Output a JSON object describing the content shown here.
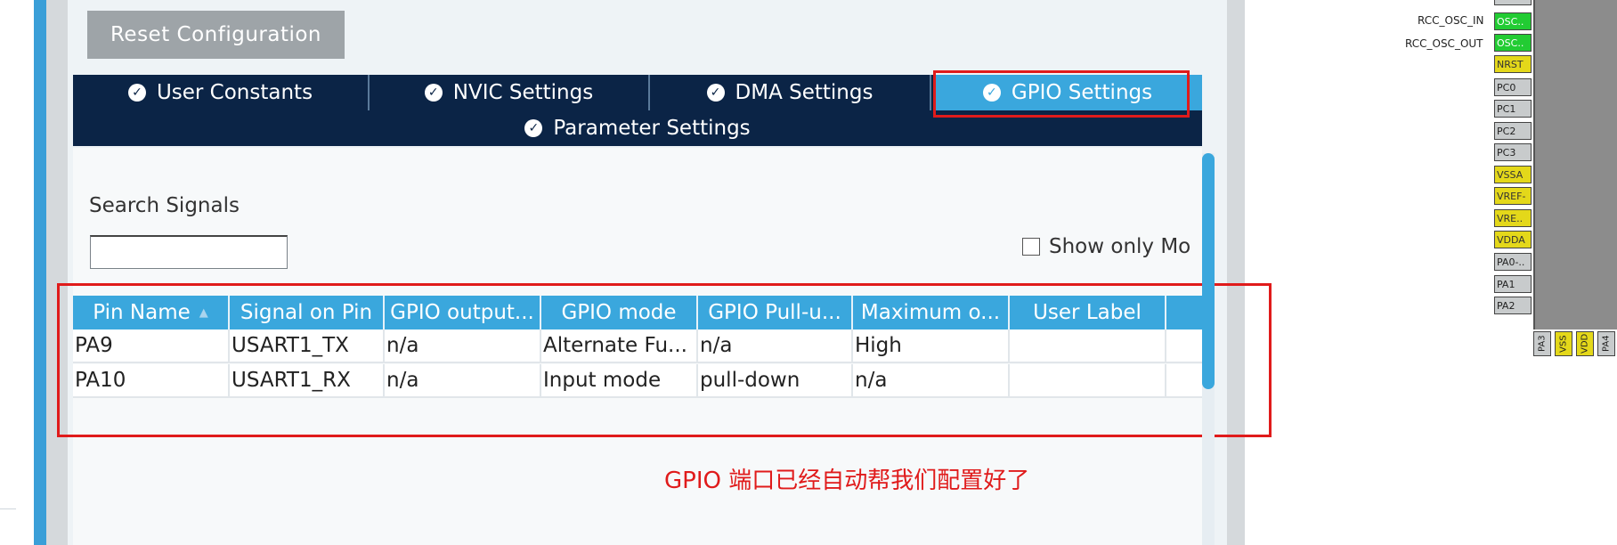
{
  "toolbar": {
    "reset_label": "Reset Configuration"
  },
  "tabs": {
    "row1": [
      {
        "label": "User Constants",
        "active": false
      },
      {
        "label": "NVIC Settings",
        "active": false
      },
      {
        "label": "DMA Settings",
        "active": false
      },
      {
        "label": "GPIO Settings",
        "active": true
      }
    ],
    "row2": [
      {
        "label": "Parameter Settings"
      }
    ]
  },
  "search": {
    "label": "Search Signals",
    "value": "",
    "placeholder": ""
  },
  "filter": {
    "show_only_label": "Show only Mo"
  },
  "table": {
    "headers": [
      "Pin Name",
      "Signal on Pin",
      "GPIO output...",
      "GPIO mode",
      "GPIO Pull-u...",
      "Maximum o...",
      "User Label",
      ""
    ],
    "rows": [
      [
        "PA9",
        "USART1_TX",
        "n/a",
        "Alternate Fu...",
        "n/a",
        "High",
        "",
        ""
      ],
      [
        "PA10",
        "USART1_RX",
        "n/a",
        "Input mode",
        "pull-down",
        "n/a",
        "",
        ""
      ]
    ]
  },
  "annotation": {
    "text": "GPIO 端口已经自动帮我们配置好了",
    "color": "#e01b1b"
  },
  "chip": {
    "signal_labels": [
      "RCC_OSC_IN",
      "RCC_OSC_OUT"
    ],
    "left_pins": [
      {
        "label": "",
        "color": "gray"
      },
      {
        "label": "OSC..",
        "color": "green"
      },
      {
        "label": "OSC..",
        "color": "green"
      },
      {
        "label": "NRST",
        "color": "yellow"
      },
      {
        "label": "PC0",
        "color": "gray"
      },
      {
        "label": "PC1",
        "color": "gray"
      },
      {
        "label": "PC2",
        "color": "gray"
      },
      {
        "label": "PC3",
        "color": "gray"
      },
      {
        "label": "VSSA",
        "color": "yellow"
      },
      {
        "label": "VREF-",
        "color": "yellow"
      },
      {
        "label": "VRE..",
        "color": "yellow"
      },
      {
        "label": "VDDA",
        "color": "yellow"
      },
      {
        "label": "PA0-..",
        "color": "gray"
      },
      {
        "label": "PA1",
        "color": "gray"
      },
      {
        "label": "PA2",
        "color": "gray"
      }
    ],
    "bottom_pins": [
      {
        "label": "PA3",
        "color": "gray"
      },
      {
        "label": "VSS",
        "color": "yellow"
      },
      {
        "label": "VDD",
        "color": "yellow"
      },
      {
        "label": "PA4",
        "color": "gray"
      }
    ]
  },
  "colors": {
    "accent": "#3aa7dd",
    "tab_bg": "#0b2446",
    "highlight": "#e01b1b",
    "pin_green": "#22cc33",
    "pin_yellow": "#e4d81a"
  }
}
